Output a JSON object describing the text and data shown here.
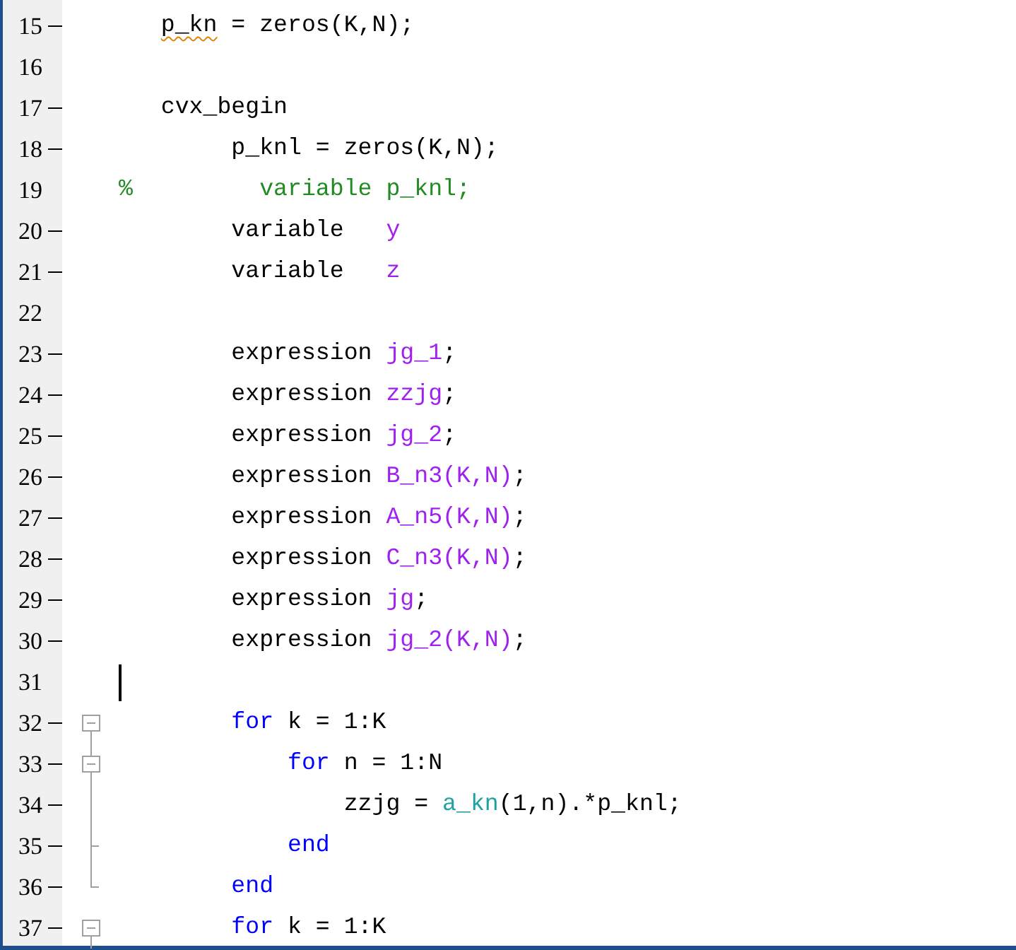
{
  "editor": {
    "lines": [
      {
        "number": "15",
        "executable": true,
        "caret": false,
        "tokens": [
          {
            "kind": "warned",
            "text": "   p_kn"
          },
          {
            "kind": "plain",
            "text": " = zeros(K,N);"
          }
        ]
      },
      {
        "number": "16",
        "executable": false,
        "caret": false
      },
      {
        "number": "17",
        "executable": true,
        "caret": false,
        "tokens": [
          {
            "kind": "plain",
            "text": "   cvx_begin"
          }
        ]
      },
      {
        "number": "18",
        "executable": true,
        "caret": false,
        "tokens": [
          {
            "kind": "plain",
            "text": "        p_knl = zeros(K,N);"
          }
        ]
      },
      {
        "number": "19",
        "executable": false,
        "caret": false,
        "tokens": [
          {
            "kind": "comment",
            "text": "%         variable p_knl;"
          }
        ]
      },
      {
        "number": "20",
        "executable": true,
        "caret": false,
        "tokens": [
          {
            "kind": "plain",
            "text": "        variable   "
          },
          {
            "kind": "name",
            "text": "y"
          }
        ]
      },
      {
        "number": "21",
        "executable": true,
        "caret": false,
        "tokens": [
          {
            "kind": "plain",
            "text": "        variable   "
          },
          {
            "kind": "name",
            "text": "z"
          }
        ]
      },
      {
        "number": "22",
        "executable": false,
        "caret": false
      },
      {
        "number": "23",
        "executable": true,
        "caret": false,
        "tokens": [
          {
            "kind": "plain",
            "text": "        expression "
          },
          {
            "kind": "name",
            "text": "jg_1"
          },
          {
            "kind": "plain",
            "text": ";"
          }
        ]
      },
      {
        "number": "24",
        "executable": true,
        "caret": false,
        "tokens": [
          {
            "kind": "plain",
            "text": "        expression "
          },
          {
            "kind": "name",
            "text": "zzjg"
          },
          {
            "kind": "plain",
            "text": ";"
          }
        ]
      },
      {
        "number": "25",
        "executable": true,
        "caret": false,
        "tokens": [
          {
            "kind": "plain",
            "text": "        expression "
          },
          {
            "kind": "name",
            "text": "jg_2"
          },
          {
            "kind": "plain",
            "text": ";"
          }
        ]
      },
      {
        "number": "26",
        "executable": true,
        "caret": false,
        "tokens": [
          {
            "kind": "plain",
            "text": "        expression "
          },
          {
            "kind": "name",
            "text": "B_n3(K,N)"
          },
          {
            "kind": "plain",
            "text": ";"
          }
        ]
      },
      {
        "number": "27",
        "executable": true,
        "caret": false,
        "tokens": [
          {
            "kind": "plain",
            "text": "        expression "
          },
          {
            "kind": "name",
            "text": "A_n5(K,N)"
          },
          {
            "kind": "plain",
            "text": ";"
          }
        ]
      },
      {
        "number": "28",
        "executable": true,
        "caret": false,
        "tokens": [
          {
            "kind": "plain",
            "text": "        expression "
          },
          {
            "kind": "name",
            "text": "C_n3(K,N)"
          },
          {
            "kind": "plain",
            "text": ";"
          }
        ]
      },
      {
        "number": "29",
        "executable": true,
        "caret": false,
        "tokens": [
          {
            "kind": "plain",
            "text": "        expression "
          },
          {
            "kind": "name",
            "text": "jg"
          },
          {
            "kind": "plain",
            "text": ";"
          }
        ]
      },
      {
        "number": "30",
        "executable": true,
        "caret": false,
        "tokens": [
          {
            "kind": "plain",
            "text": "        expression "
          },
          {
            "kind": "name",
            "text": "jg_2(K,N)"
          },
          {
            "kind": "plain",
            "text": ";"
          }
        ]
      },
      {
        "number": "31",
        "executable": false,
        "caret": true
      },
      {
        "number": "32",
        "executable": true,
        "caret": false,
        "fold": {
          "kind": "start"
        },
        "tokens": [
          {
            "kind": "keyword",
            "text": "        for"
          },
          {
            "kind": "plain",
            "text": " k = 1:K"
          }
        ]
      },
      {
        "number": "33",
        "executable": true,
        "caret": false,
        "fold": {
          "kind": "nested_start"
        },
        "tokens": [
          {
            "kind": "keyword",
            "text": "            for"
          },
          {
            "kind": "plain",
            "text": " n = 1:N"
          }
        ]
      },
      {
        "number": "34",
        "executable": true,
        "caret": false,
        "fold": {
          "kind": "inner"
        },
        "tokens": [
          {
            "kind": "plain",
            "text": "                zzjg = "
          },
          {
            "kind": "function",
            "text": "a_kn"
          },
          {
            "kind": "plain",
            "text": "(1,n).*p_knl;"
          }
        ]
      },
      {
        "number": "35",
        "executable": true,
        "caret": false,
        "fold": {
          "kind": "nested_end"
        },
        "tokens": [
          {
            "kind": "keyword",
            "text": "            end"
          }
        ]
      },
      {
        "number": "36",
        "executable": true,
        "caret": false,
        "fold": {
          "kind": "end"
        },
        "tokens": [
          {
            "kind": "keyword",
            "text": "        end"
          }
        ]
      },
      {
        "number": "37",
        "executable": true,
        "caret": false,
        "fold": {
          "kind": "start"
        },
        "tokens": [
          {
            "kind": "keyword",
            "text": "        for"
          },
          {
            "kind": "plain",
            "text": " k = 1:K"
          }
        ]
      }
    ]
  }
}
